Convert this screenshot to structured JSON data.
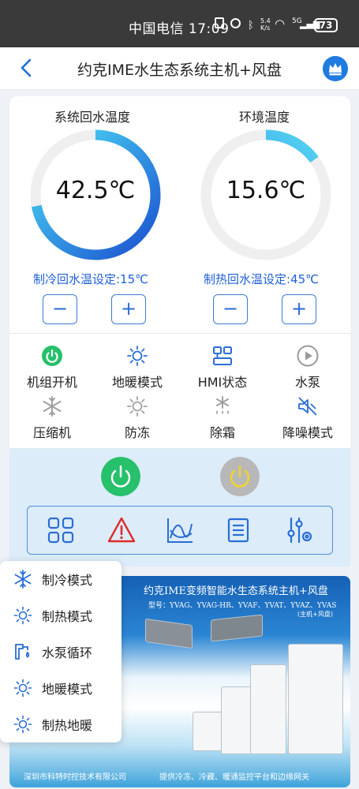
{
  "status_bar": {
    "carrier_time": "中国电信 17:09",
    "network_speed": "5.4 K/s",
    "signal": "5G",
    "battery": "73"
  },
  "header": {
    "title": "约克IME水生态系统主机+风盘"
  },
  "gauges": [
    {
      "title": "系统回水温度",
      "value": "42.5℃",
      "fill": 0.72
    },
    {
      "title": "环境温度",
      "value": "15.6℃",
      "fill": 0.15
    }
  ],
  "settings": {
    "cooling_setpoint": "制冷回水温设定:15℃",
    "heating_setpoint": "制热回水温设定:45℃"
  },
  "steppers": {
    "minus": "−",
    "plus": "+"
  },
  "status_items": [
    {
      "label": "机组开机",
      "icon": "power-on-icon",
      "active": true
    },
    {
      "label": "地暖模式",
      "icon": "sun-icon",
      "active": true
    },
    {
      "label": "HMI状态",
      "icon": "hmi-icon",
      "active": true
    },
    {
      "label": "水泵",
      "icon": "pump-play-icon",
      "active": false
    },
    {
      "label": "压缩机",
      "icon": "snowflake-icon",
      "active": false
    },
    {
      "label": "防冻",
      "icon": "sun-icon",
      "active": false
    },
    {
      "label": "除霜",
      "icon": "defrost-icon",
      "active": false
    },
    {
      "label": "降噪模式",
      "icon": "mute-icon",
      "active": true
    }
  ],
  "colors": {
    "accent": "#2a6dd6",
    "power_on": "#27c06b",
    "power_off": "#b8b8b8",
    "alarm": "#e02b2b",
    "panel": "#dcecf8"
  },
  "banner": {
    "title": "约克IME变频智能水生态系统主机+风盘",
    "models": "型号：YVAG、YVAG-HR、YVAF、YVAT、YVAZ、YVAS",
    "subtitle": "(主机+风盘)",
    "company": "深圳市科特时控技术有限公司",
    "slogan": "提供冷冻、冷藏、暖通监控平台和边缘网关"
  },
  "menu": {
    "items": [
      {
        "label": "制冷模式",
        "icon": "snowflake-icon"
      },
      {
        "label": "制热模式",
        "icon": "sun-icon"
      },
      {
        "label": "水泵循环",
        "icon": "pump-icon"
      },
      {
        "label": "地暖模式",
        "icon": "sun-icon"
      },
      {
        "label": "制热地暖",
        "icon": "sun-icon"
      }
    ]
  }
}
